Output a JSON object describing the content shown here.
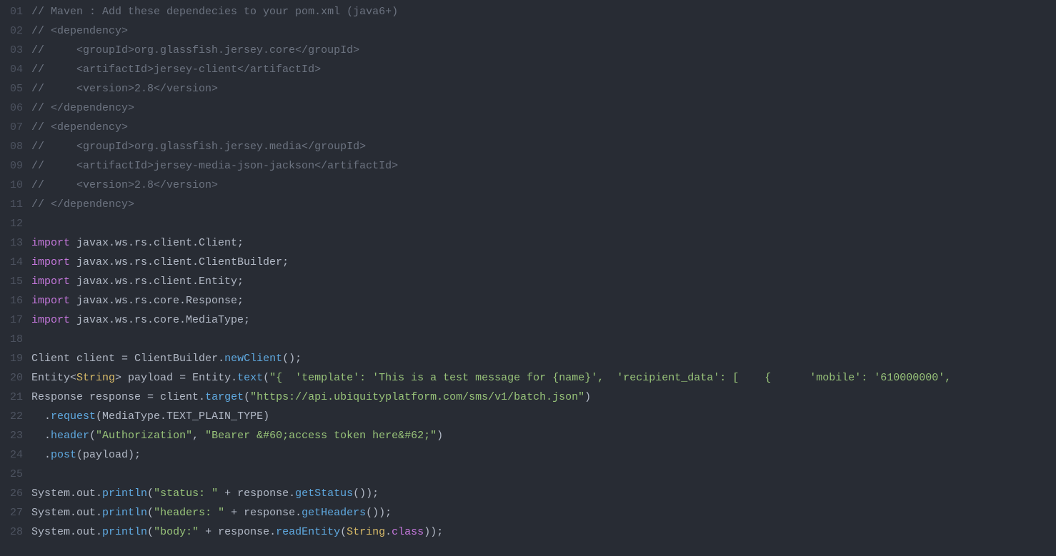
{
  "lines": [
    {
      "n": "01",
      "seg": [
        [
          "c",
          "// Maven : Add these dependecies to your pom.xml (java6+)"
        ]
      ]
    },
    {
      "n": "02",
      "seg": [
        [
          "c",
          "// <dependency>"
        ]
      ]
    },
    {
      "n": "03",
      "seg": [
        [
          "c",
          "//     <groupId>org.glassfish.jersey.core</groupId>"
        ]
      ]
    },
    {
      "n": "04",
      "seg": [
        [
          "c",
          "//     <artifactId>jersey-client</artifactId>"
        ]
      ]
    },
    {
      "n": "05",
      "seg": [
        [
          "c",
          "//     <version>2.8</version>"
        ]
      ]
    },
    {
      "n": "06",
      "seg": [
        [
          "c",
          "// </dependency>"
        ]
      ]
    },
    {
      "n": "07",
      "seg": [
        [
          "c",
          "// <dependency>"
        ]
      ]
    },
    {
      "n": "08",
      "seg": [
        [
          "c",
          "//     <groupId>org.glassfish.jersey.media</groupId>"
        ]
      ]
    },
    {
      "n": "09",
      "seg": [
        [
          "c",
          "//     <artifactId>jersey-media-json-jackson</artifactId>"
        ]
      ]
    },
    {
      "n": "10",
      "seg": [
        [
          "c",
          "//     <version>2.8</version>"
        ]
      ]
    },
    {
      "n": "11",
      "seg": [
        [
          "c",
          "// </dependency>"
        ]
      ]
    },
    {
      "n": "12",
      "seg": [
        [
          "p",
          ""
        ]
      ]
    },
    {
      "n": "13",
      "seg": [
        [
          "k",
          "import"
        ],
        [
          "p",
          " javax.ws.rs.client.Client;"
        ]
      ]
    },
    {
      "n": "14",
      "seg": [
        [
          "k",
          "import"
        ],
        [
          "p",
          " javax.ws.rs.client.ClientBuilder;"
        ]
      ]
    },
    {
      "n": "15",
      "seg": [
        [
          "k",
          "import"
        ],
        [
          "p",
          " javax.ws.rs.client.Entity;"
        ]
      ]
    },
    {
      "n": "16",
      "seg": [
        [
          "k",
          "import"
        ],
        [
          "p",
          " javax.ws.rs.core.Response;"
        ]
      ]
    },
    {
      "n": "17",
      "seg": [
        [
          "k",
          "import"
        ],
        [
          "p",
          " javax.ws.rs.core.MediaType;"
        ]
      ]
    },
    {
      "n": "18",
      "seg": [
        [
          "p",
          ""
        ]
      ]
    },
    {
      "n": "19",
      "seg": [
        [
          "p",
          "Client client "
        ],
        [
          "p",
          "= "
        ],
        [
          "p",
          "ClientBuilder."
        ],
        [
          "m",
          "newClient"
        ],
        [
          "p",
          "();"
        ]
      ]
    },
    {
      "n": "20",
      "seg": [
        [
          "p",
          "Entity"
        ],
        [
          "p",
          "<"
        ],
        [
          "t",
          "String"
        ],
        [
          "p",
          "> payload "
        ],
        [
          "p",
          "= "
        ],
        [
          "p",
          "Entity."
        ],
        [
          "m",
          "text"
        ],
        [
          "p",
          "("
        ],
        [
          "s",
          "\"{  'template': 'This is a test message for {name}',  'recipient_data': [    {      'mobile': '610000000',"
        ]
      ]
    },
    {
      "n": "21",
      "seg": [
        [
          "p",
          "Response response "
        ],
        [
          "p",
          "= "
        ],
        [
          "p",
          "client."
        ],
        [
          "m",
          "target"
        ],
        [
          "p",
          "("
        ],
        [
          "s",
          "\"https://api.ubiquityplatform.com/sms/v1/batch.json\""
        ],
        [
          "p",
          ")"
        ]
      ]
    },
    {
      "n": "22",
      "seg": [
        [
          "p",
          "  ."
        ],
        [
          "m",
          "request"
        ],
        [
          "p",
          "(MediaType.TEXT_PLAIN_TYPE)"
        ]
      ]
    },
    {
      "n": "23",
      "seg": [
        [
          "p",
          "  ."
        ],
        [
          "m",
          "header"
        ],
        [
          "p",
          "("
        ],
        [
          "s",
          "\"Authorization\""
        ],
        [
          "p",
          ", "
        ],
        [
          "s",
          "\"Bearer &#60;access token here&#62;\""
        ],
        [
          "p",
          ")"
        ]
      ]
    },
    {
      "n": "24",
      "seg": [
        [
          "p",
          "  ."
        ],
        [
          "m",
          "post"
        ],
        [
          "p",
          "(payload);"
        ]
      ]
    },
    {
      "n": "25",
      "seg": [
        [
          "p",
          ""
        ]
      ]
    },
    {
      "n": "26",
      "seg": [
        [
          "p",
          "System.out."
        ],
        [
          "m",
          "println"
        ],
        [
          "p",
          "("
        ],
        [
          "s",
          "\"status: \""
        ],
        [
          "p",
          " + response."
        ],
        [
          "m",
          "getStatus"
        ],
        [
          "p",
          "());"
        ]
      ]
    },
    {
      "n": "27",
      "seg": [
        [
          "p",
          "System.out."
        ],
        [
          "m",
          "println"
        ],
        [
          "p",
          "("
        ],
        [
          "s",
          "\"headers: \""
        ],
        [
          "p",
          " + response."
        ],
        [
          "m",
          "getHeaders"
        ],
        [
          "p",
          "());"
        ]
      ]
    },
    {
      "n": "28",
      "seg": [
        [
          "p",
          "System.out."
        ],
        [
          "m",
          "println"
        ],
        [
          "p",
          "("
        ],
        [
          "s",
          "\"body:\""
        ],
        [
          "p",
          " + response."
        ],
        [
          "m",
          "readEntity"
        ],
        [
          "p",
          "("
        ],
        [
          "t",
          "String"
        ],
        [
          "p",
          "."
        ],
        [
          "k",
          "class"
        ],
        [
          "p",
          "));"
        ]
      ]
    }
  ]
}
